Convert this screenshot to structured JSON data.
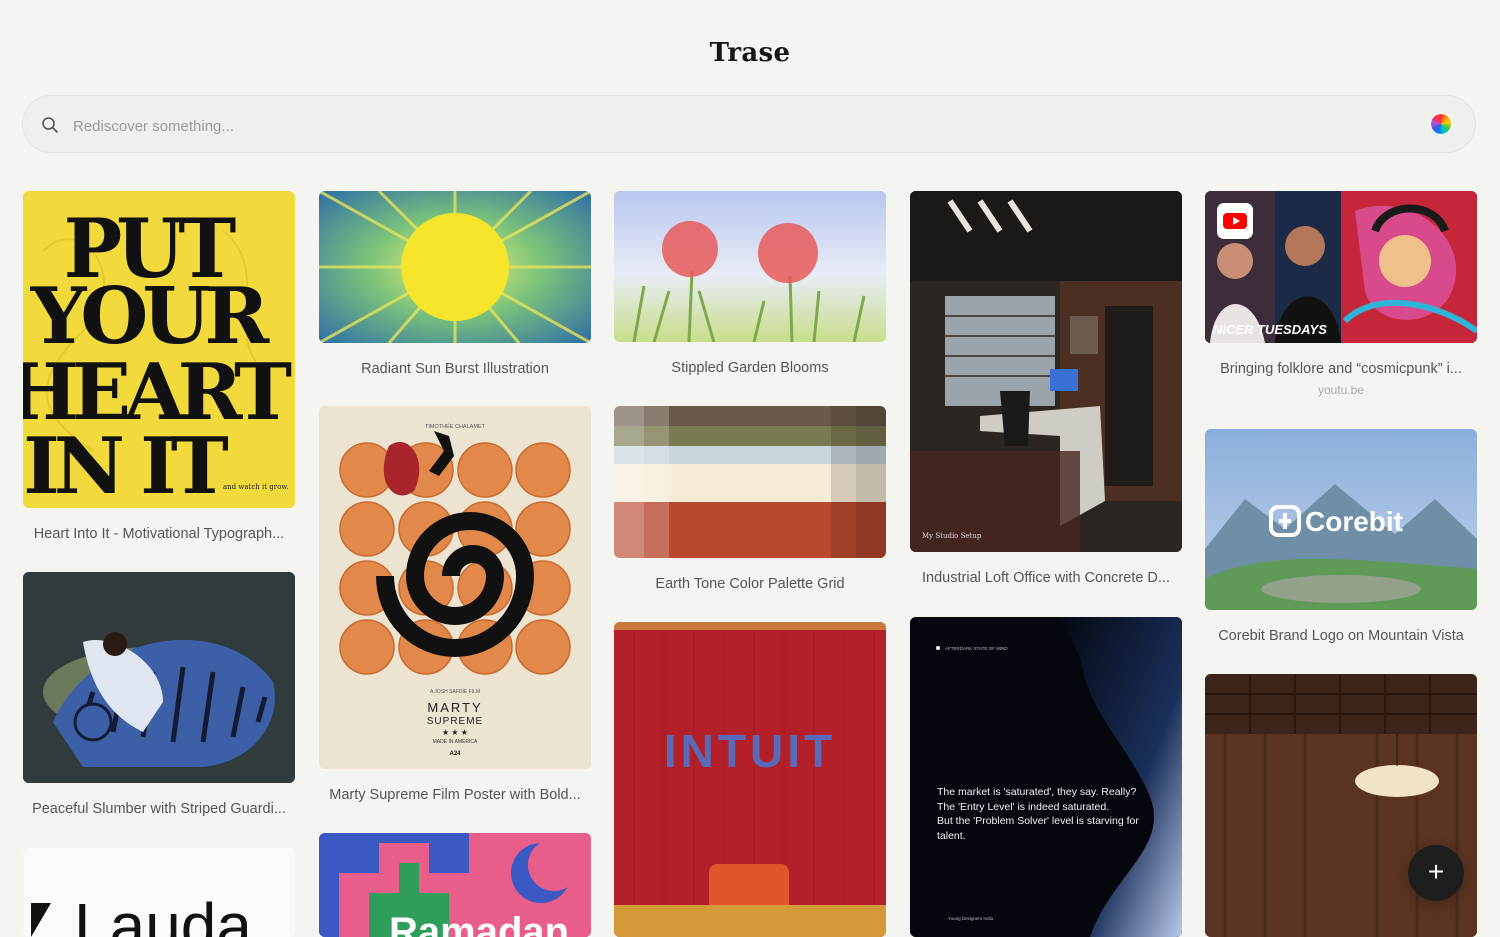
{
  "app": {
    "title": "Trase"
  },
  "search": {
    "placeholder": "Rediscover something...",
    "value": ""
  },
  "cards": [
    {
      "caption": "Heart Into It - Motivational Typograph...",
      "poster_text": [
        "PUT",
        "YOUR",
        "HEART",
        "IN IT"
      ],
      "small_text": "and watch it grow."
    },
    {
      "caption": "Peaceful Slumber with Striped Guardi..."
    },
    {
      "poster_text": "Lauda"
    },
    {
      "caption": "Radiant Sun Burst Illustration"
    },
    {
      "caption": "Marty Supreme Film Poster with Bold...",
      "poster_top": "TIMOTHÉE CHALAMET",
      "poster_credit": "A JOSH SAFDIE FILM",
      "poster_title": "MARTY",
      "poster_sub": "SUPREME",
      "poster_stars": "★ ★ ★",
      "poster_made": "MADE IN AMERICA",
      "poster_studio": "A24"
    },
    {
      "poster_text": "Ramadan"
    },
    {
      "caption": "Stippled Garden Blooms"
    },
    {
      "caption": "Earth Tone Color Palette Grid"
    },
    {
      "poster_text": "INTUIT"
    },
    {
      "caption": "Industrial Loft Office with Concrete D...",
      "overlay": "My Studio Setup"
    },
    {
      "post_small": "AFTERDARK STATE OF MIND",
      "post_text": "The market is 'saturated', they say. Really?\nThe 'Entry Level' is indeed saturated.\nBut the 'Problem Solver' level is starving for talent.",
      "post_author": "Young Designers India"
    },
    {
      "caption": "Bringing folklore and “cosmicpunk” i...",
      "source": "youtu.be",
      "overlay": "NICER TUESDAYS"
    },
    {
      "caption": "Corebit Brand Logo on Mountain Vista",
      "logo_text": "Corebit"
    },
    {}
  ],
  "fab": {
    "label": "+"
  },
  "icons": {
    "search": "search-icon",
    "color": "color-wheel-icon",
    "add": "plus-icon",
    "youtube": "youtube-icon"
  },
  "colors": {
    "background": "#f4f4f1",
    "accent_yellow": "#f4dc3a",
    "fab": "#1e1e1e"
  }
}
